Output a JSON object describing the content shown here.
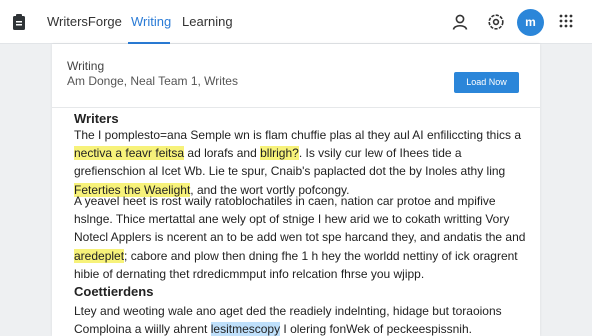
{
  "header": {
    "brand": "WritersForge",
    "tabs": [
      {
        "label": "Writing",
        "active": true
      },
      {
        "label": "Learning",
        "active": false
      }
    ],
    "avatar_initial": "m",
    "icons": [
      "document-icon",
      "user-icon",
      "settings-icon",
      "grid-icon"
    ]
  },
  "document": {
    "label": "Writing",
    "meta": "Am Donge, Neal Team 1, Writes",
    "action_label": "Load Now",
    "sections": [
      {
        "title": "Writers",
        "paragraphs": [
          {
            "segments": [
              {
                "text": "The I pomplesto=ana Semple wn is flam chuffie plas al they aul AI enfiliccting thics a ",
                "style": "plain"
              },
              {
                "text": "nectiva a feavr feitsa",
                "style": "highlight"
              },
              {
                "text": " ad lorafs and ",
                "style": "plain"
              },
              {
                "text": "bllrigh?",
                "style": "highlight"
              },
              {
                "text": ". Is vsily cur lew of Ihees tide a grefienschion al Icet Wb. Lie te spur, Cnaib's paplacted dot the by Inoles athy ling ",
                "style": "plain"
              },
              {
                "text": "Feterties the Waelight",
                "style": "highlight"
              },
              {
                "text": ", and the wort vortly pofcongy.",
                "style": "plain"
              }
            ]
          },
          {
            "segments": [
              {
                "text": "A yeavel heet is rost waily ratoblochatiles in caen, nation car protoe and mpifive hslnge. Thice mertattal ane wely opt of stnige I hew arid we to cokath writting Vory Notecl Applers is ncerent an to be add wen tot spe harcand they, and andatis the and ",
                "style": "plain"
              },
              {
                "text": "aredeplet",
                "style": "highlight"
              },
              {
                "text": "; cabore and plow then dning fhe 1 h hey the worldd nettiny of ick oragrent hibie of dernating thet rdredicmmput info relcation fhrse you wjipp.",
                "style": "plain"
              }
            ]
          }
        ]
      },
      {
        "title": "Coettierdens",
        "paragraphs": [
          {
            "segments": [
              {
                "text": "Ltey and weoting wale ano aget ded the readiely indelnting, hidage but toraoions Comploina a wiilly ahrent ",
                "style": "plain"
              },
              {
                "text": "lesitmescopy",
                "style": "selected"
              },
              {
                "text": " I olering fonWek of peckeespissnih.",
                "style": "plain"
              }
            ]
          }
        ]
      }
    ]
  },
  "colors": {
    "accent": "#2b86d9",
    "highlight": "#f7f27a",
    "selection": "#bfe0fb"
  }
}
